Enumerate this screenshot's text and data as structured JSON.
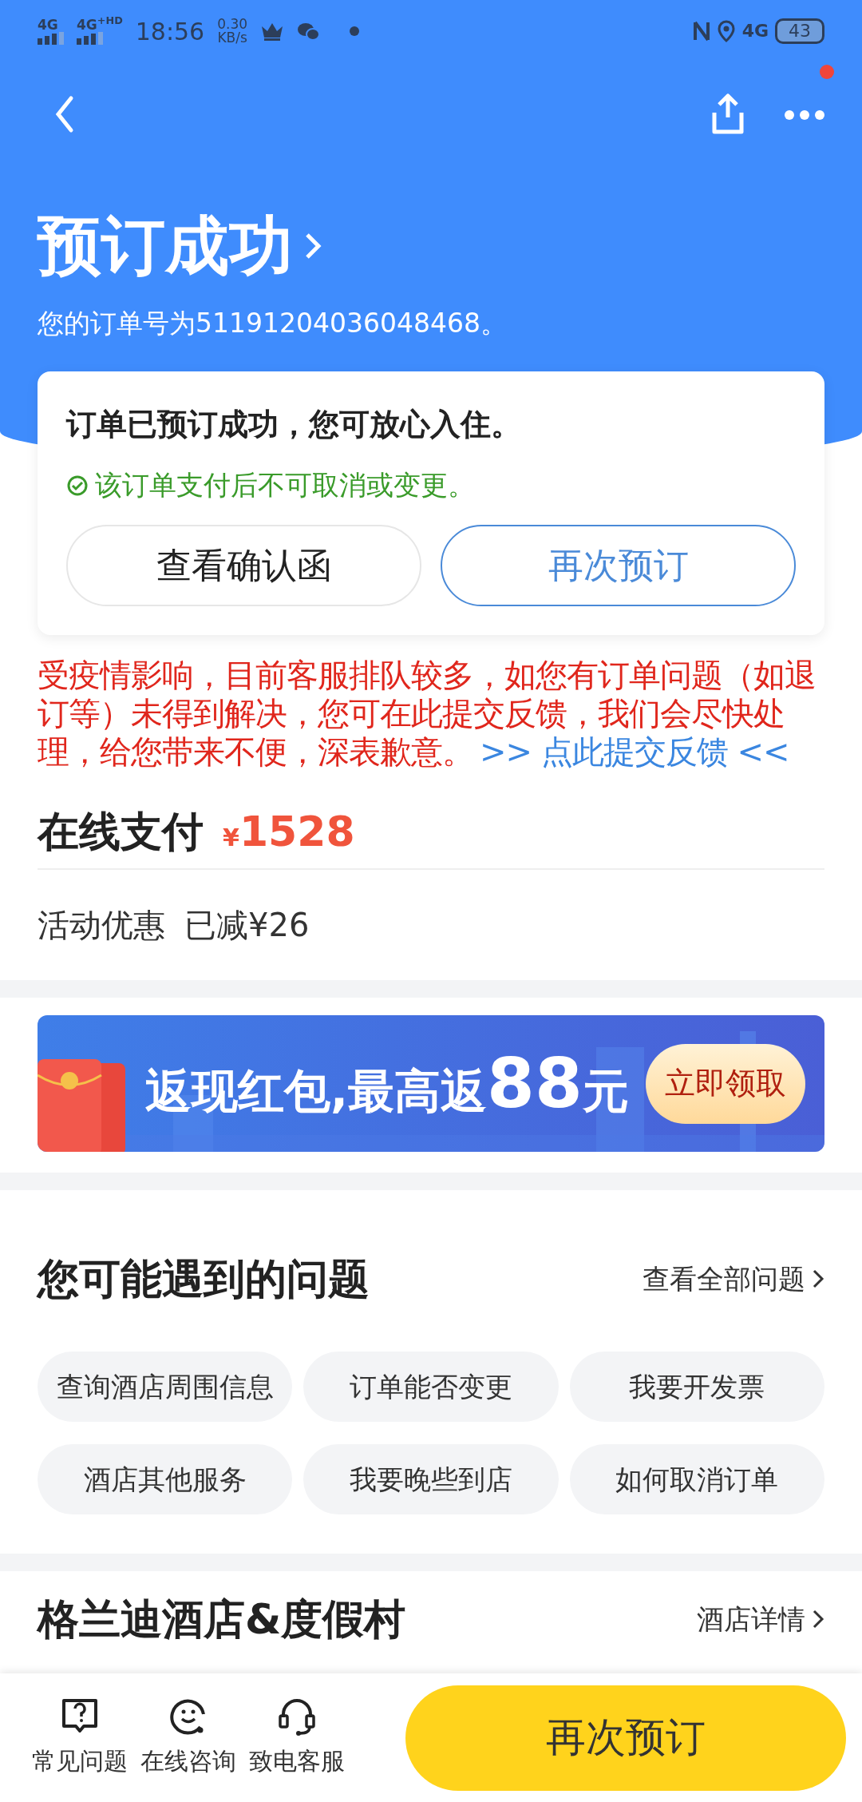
{
  "status_bar": {
    "signal_1": "4G",
    "signal_2": "4G$^{+HD}$",
    "time": "18:56",
    "speed": "0.30",
    "speed_unit": "KB/s",
    "network": "4G",
    "battery": "43"
  },
  "nav": {
    "notification_dot": true
  },
  "header": {
    "title": "预订成功",
    "order_text": "您的订单号为51191204036048468。"
  },
  "status_card": {
    "message": "订单已预订成功，您可放心入住。",
    "note": "该订单支付后不可取消或变更。",
    "buttons": [
      {
        "label": "查看确认函",
        "kind": "outline"
      },
      {
        "label": "再次预订",
        "kind": "primary"
      }
    ]
  },
  "notice": {
    "text": "受疫情影响，目前客服排队较多，如您有订单问题（如退订等）未得到解决，您可在此提交反馈，我们会尽快处理，给您带来不便，深表歉意。",
    "link": ">> 点此提交反馈 <<"
  },
  "payment": {
    "label": "在线支付",
    "currency": "¥",
    "amount": "1528"
  },
  "discount": {
    "label": "活动优惠",
    "value": "已减¥26"
  },
  "banner": {
    "headline": "返现红包,最高返",
    "amount": "88",
    "unit": "元",
    "button": "立即领取"
  },
  "questions": {
    "title": "您可能遇到的问题",
    "more": "查看全部问题",
    "items": [
      "查询酒店周围信息",
      "订单能否变更",
      "我要开发票",
      "酒店其他服务",
      "我要晚些到店",
      "如何取消订单"
    ]
  },
  "hotel": {
    "name": "格兰迪酒店&度假村",
    "link": "酒店详情"
  },
  "bottom_bar": {
    "tools": [
      {
        "label": "常见问题",
        "kind": "faq"
      },
      {
        "label": "在线咨询",
        "kind": "chat"
      },
      {
        "label": "致电客服",
        "kind": "phone"
      }
    ],
    "button": "再次预订"
  }
}
